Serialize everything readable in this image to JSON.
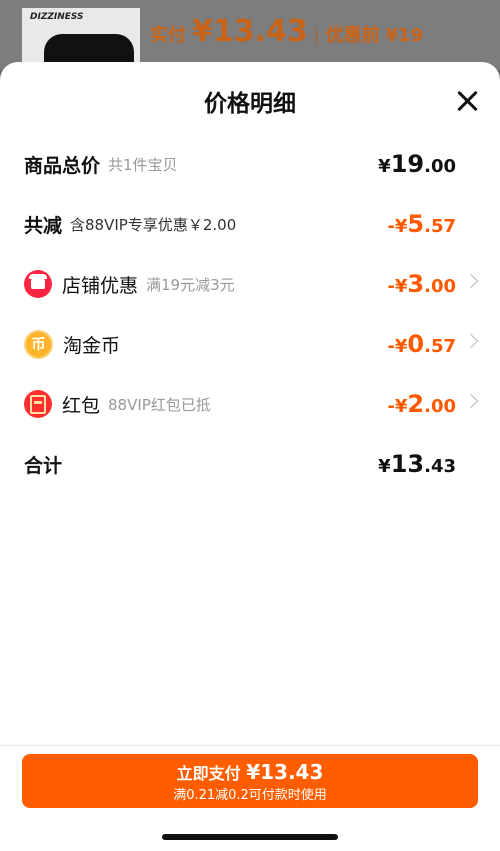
{
  "background": {
    "brand_text": "DIZZINESS",
    "actual_label": "实付",
    "actual_amount": "¥13.43",
    "separator": "|",
    "original_label": "优惠前",
    "original_amount": "¥19"
  },
  "sheet": {
    "title": "价格明细",
    "rows": {
      "total": {
        "label": "商品总价",
        "note": "共1件宝贝",
        "currency": "¥",
        "int": "19",
        "dec": ".00"
      },
      "reduction": {
        "label": "共减",
        "note": "含88VIP专享优惠￥2.00",
        "currency": "-¥",
        "int": "5",
        "dec": ".57"
      },
      "store_discount": {
        "icon": "store-icon",
        "label": "店铺优惠",
        "note": "满19元减3元",
        "currency": "-¥",
        "int": "3",
        "dec": ".00"
      },
      "taojin_coin": {
        "icon": "coin-icon",
        "coin_char": "币",
        "label": "淘金币",
        "currency": "-¥",
        "int": "0",
        "dec": ".57"
      },
      "red_packet": {
        "icon": "red-packet-icon",
        "label": "红包",
        "note": "88VIP红包已抵",
        "currency": "-¥",
        "int": "2",
        "dec": ".00"
      },
      "sum": {
        "label": "合计",
        "currency": "¥",
        "int": "13",
        "dec": ".43"
      }
    }
  },
  "pay_button": {
    "label": "立即支付",
    "amount": "¥13.43",
    "subtext": "满0.21减0.2可付款时使用"
  },
  "colors": {
    "accent": "#ff5d00",
    "discount": "#ff5a00"
  }
}
